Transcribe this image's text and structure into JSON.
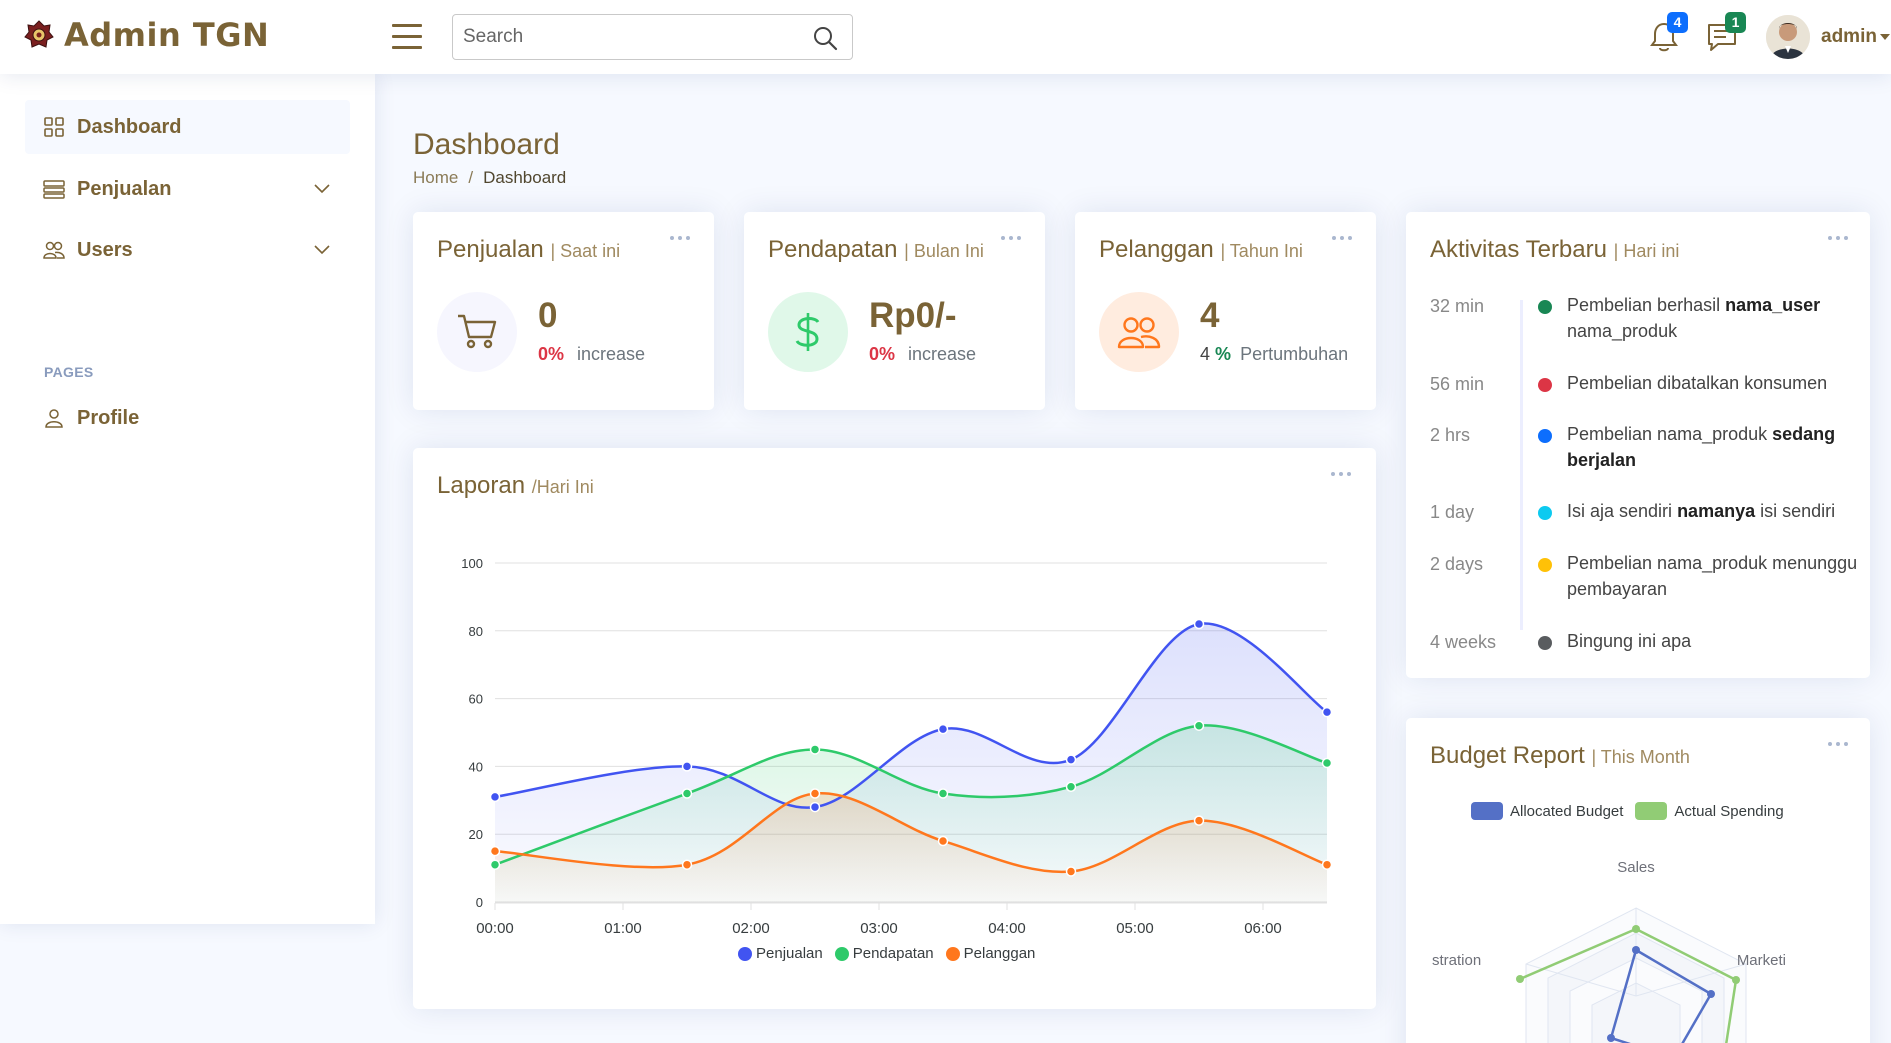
{
  "header": {
    "app_title": "Admin TGN",
    "search_placeholder": "Search",
    "notifications_count": "4",
    "messages_count": "1",
    "user_name": "admin"
  },
  "sidebar": {
    "items": [
      {
        "label": "Dashboard"
      },
      {
        "label": "Penjualan"
      },
      {
        "label": "Users"
      }
    ],
    "pages_heading": "PAGES",
    "page_items": [
      {
        "label": "Profile"
      }
    ]
  },
  "page": {
    "title": "Dashboard",
    "breadcrumb": {
      "home": "Home",
      "separator": "/",
      "current": "Dashboard"
    }
  },
  "cards": {
    "sales": {
      "title": "Penjualan",
      "filter": "| Saat ini",
      "value": "0",
      "pct": "0%",
      "label": "increase"
    },
    "revenue": {
      "title": "Pendapatan",
      "filter": "| Bulan Ini",
      "value": "Rp0/-",
      "pct": "0%",
      "label": "increase"
    },
    "customers": {
      "title": "Pelanggan",
      "filter": "| Tahun Ini",
      "value": "4",
      "count": "4",
      "pct": "%",
      "label": "Pertumbuhan"
    }
  },
  "report": {
    "title": "Laporan",
    "filter": "/Hari Ini"
  },
  "activity": {
    "title": "Aktivitas Terbaru",
    "filter": "| Hari ini",
    "items": [
      {
        "time": "32 min",
        "color": "#198754",
        "text_a": "Pembelian berhasil ",
        "bold": "nama_user",
        "text_b": " nama_produk"
      },
      {
        "time": "56 min",
        "color": "#dc3545",
        "text_a": "Pembelian dibatalkan konsumen",
        "bold": "",
        "text_b": ""
      },
      {
        "time": "2 hrs",
        "color": "#0d6efd",
        "text_a": "Pembelian nama_produk ",
        "bold": "sedang berjalan",
        "text_b": ""
      },
      {
        "time": "1 day",
        "color": "#0dcaf0",
        "text_a": "Isi aja sendiri ",
        "bold": "namanya",
        "text_b": " isi sendiri"
      },
      {
        "time": "2 days",
        "color": "#ffc107",
        "text_a": "Pembelian nama_produk menunggu pembayaran",
        "bold": "",
        "text_b": ""
      },
      {
        "time": "4 weeks",
        "color": "#595c5f",
        "text_a": "Bingung ini apa",
        "bold": "",
        "text_b": ""
      }
    ]
  },
  "budget": {
    "title": "Budget Report",
    "filter": "| This Month",
    "legend": [
      {
        "name": "Allocated Budget",
        "color": "#5470c6"
      },
      {
        "name": "Actual Spending",
        "color": "#91cc75"
      }
    ],
    "axis_labels": [
      "Sales",
      "Marketi",
      "stration"
    ]
  },
  "chart_data": [
    {
      "type": "area",
      "x": [
        "00:00",
        "01:00",
        "02:00",
        "03:00",
        "04:00",
        "05:00",
        "06:00"
      ],
      "ylim": [
        0,
        100
      ],
      "yticks": [
        0,
        20,
        40,
        60,
        80,
        100
      ],
      "grid": true,
      "legend_position": "bottom",
      "series": [
        {
          "name": "Penjualan",
          "color": "#4154f1",
          "x": [
            0,
            1,
            2,
            3,
            4,
            5,
            6
          ],
          "values": [
            31,
            40,
            28,
            51,
            42,
            82,
            56
          ]
        },
        {
          "name": "Pendapatan",
          "color": "#2eca6a",
          "x": [
            0,
            1,
            2,
            3,
            4,
            5,
            6
          ],
          "values": [
            11,
            32,
            45,
            32,
            34,
            52,
            41
          ]
        },
        {
          "name": "Pelanggan",
          "color": "#ff771d",
          "x": [
            0,
            1,
            2,
            3,
            4,
            5,
            6
          ],
          "values": [
            15,
            11,
            32,
            18,
            9,
            24,
            11
          ]
        }
      ]
    },
    {
      "type": "radar",
      "legend_position": "top",
      "axes": [
        "Sales",
        "Marketi",
        "stration"
      ],
      "series": [
        {
          "name": "Allocated Budget",
          "color": "#5470c6"
        },
        {
          "name": "Actual Spending",
          "color": "#91cc75"
        }
      ]
    }
  ]
}
